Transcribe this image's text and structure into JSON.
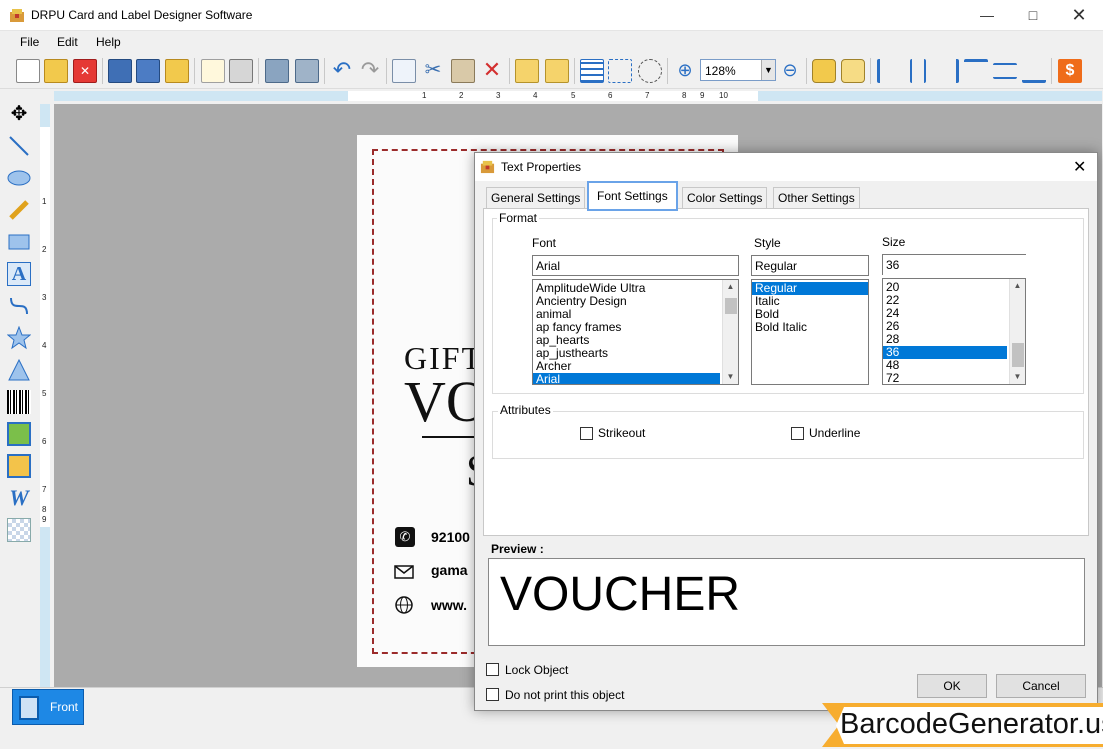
{
  "window": {
    "title": "DRPU Card and Label Designer Software"
  },
  "menu": [
    "File",
    "Edit",
    "Help"
  ],
  "toolbar": {
    "zoom": "128%"
  },
  "ruler": {
    "top_ticks": [
      "1",
      "2",
      "3",
      "4",
      "5",
      "6",
      "7",
      "8",
      "9",
      "10"
    ],
    "left_ticks": [
      "1",
      "2",
      "3",
      "4",
      "5",
      "6",
      "7",
      "8",
      "9"
    ]
  },
  "card": {
    "line1": "GIFT",
    "line2": "VO",
    "line3": "S",
    "phone": "92100",
    "email": "gama",
    "web": "www."
  },
  "page_tab": "Front",
  "dialog": {
    "title": "Text Properties",
    "tabs": [
      "General Settings",
      "Font Settings",
      "Color Settings",
      "Other Settings"
    ],
    "active_tab": "Font Settings",
    "format_label": "Format",
    "font_label": "Font",
    "style_label": "Style",
    "size_label": "Size",
    "font_value": "Arial",
    "style_value": "Regular",
    "size_value": "36",
    "fonts": [
      "AmplitudeWide Ultra",
      "Ancientry  Design",
      "animal",
      "ap fancy frames",
      "ap_hearts",
      "ap_justhearts",
      "Archer",
      "Arial"
    ],
    "styles": [
      "Regular",
      "Italic",
      "Bold",
      "Bold Italic"
    ],
    "sizes": [
      "20",
      "22",
      "24",
      "26",
      "28",
      "36",
      "48",
      "72"
    ],
    "attributes_label": "Attributes",
    "strikeout_label": "Strikeout",
    "underline_label": "Underline",
    "preview_label": "Preview :",
    "preview_text": "VOUCHER",
    "lock_label": "Lock Object",
    "noprint_label": "Do not print this object",
    "ok_label": "OK",
    "cancel_label": "Cancel"
  },
  "watermark": "BarcodeGenerator.us",
  "colors": {
    "accent": "#0078d7",
    "card_border": "#9b2b2b",
    "watermark": "#f7ad2f"
  }
}
